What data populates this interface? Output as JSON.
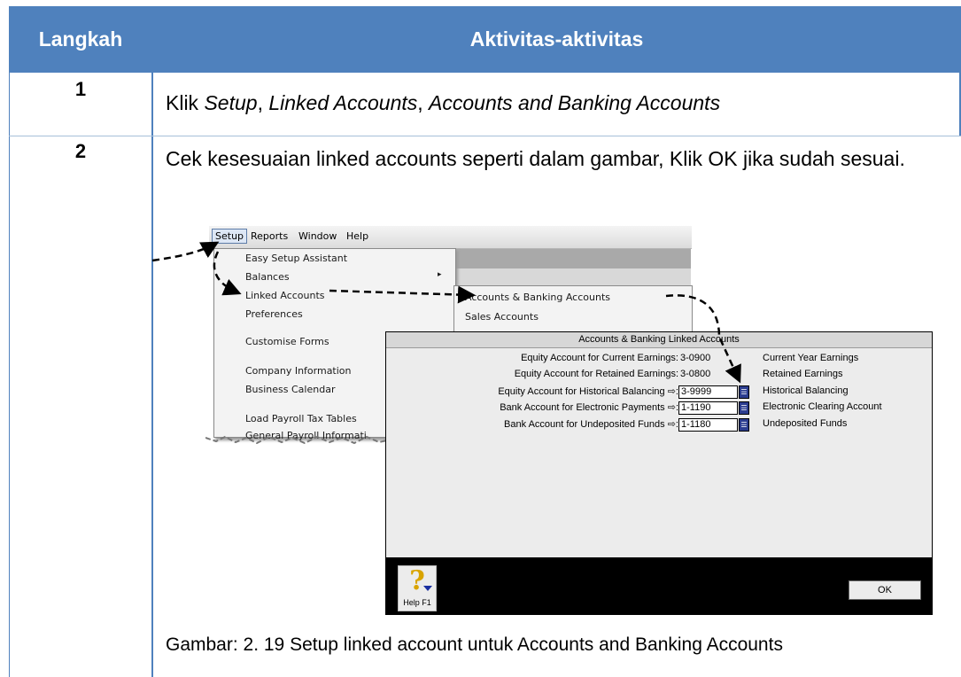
{
  "table": {
    "header": {
      "col1": "Langkah",
      "col2": "Aktivitas-aktivitas"
    },
    "rows": [
      {
        "step": "1",
        "text_parts": [
          "Klik ",
          "Setup",
          ", ",
          "Linked Accounts",
          ", ",
          "Accounts and Banking Accounts"
        ]
      },
      {
        "step": "2",
        "text": "Cek kesesuaian linked accounts seperti dalam gambar, Klik OK jika sudah sesuai."
      }
    ],
    "caption": "Gambar: 2. 19 Setup linked account untuk Accounts and Banking Accounts"
  },
  "screenshot": {
    "menubar": [
      "Setup",
      "Reports",
      "Window",
      "Help"
    ],
    "setup_menu": [
      "Easy Setup Assistant",
      "Balances",
      "Linked Accounts",
      "Preferences",
      "Customise Forms",
      "Company Information",
      "Business Calendar",
      "Load Payroll Tax Tables",
      "General Payroll Informati"
    ],
    "submenu": [
      "Accounts & Banking Accounts",
      "Sales Accounts"
    ],
    "dialog": {
      "title": "Accounts & Banking Linked Accounts",
      "rows": [
        {
          "label": "Equity Account for Current Earnings:",
          "account": "3-0900",
          "name": "Current Year Earnings",
          "editable": false
        },
        {
          "label": "Equity Account for Retained Earnings:",
          "account": "3-0800",
          "name": "Retained Earnings",
          "editable": false
        },
        {
          "label": "Equity Account for Historical Balancing ⇨:",
          "account": "3-9999",
          "name": "Historical Balancing",
          "editable": true
        },
        {
          "label": "Bank Account for Electronic Payments ⇨:",
          "account": "1-1190",
          "name": "Electronic Clearing Account",
          "editable": true
        },
        {
          "label": "Bank Account for Undeposited Funds ⇨:",
          "account": "1-1180",
          "name": "Undeposited Funds",
          "editable": true
        }
      ],
      "help_button": "Help F1",
      "ok_button": "OK"
    }
  },
  "colors": {
    "header_bg": "#4f81bd",
    "header_text": "#ffffff"
  },
  "icons": [
    "help-question-icon",
    "lookup-list-icon",
    "submenu-arrow-icon"
  ]
}
